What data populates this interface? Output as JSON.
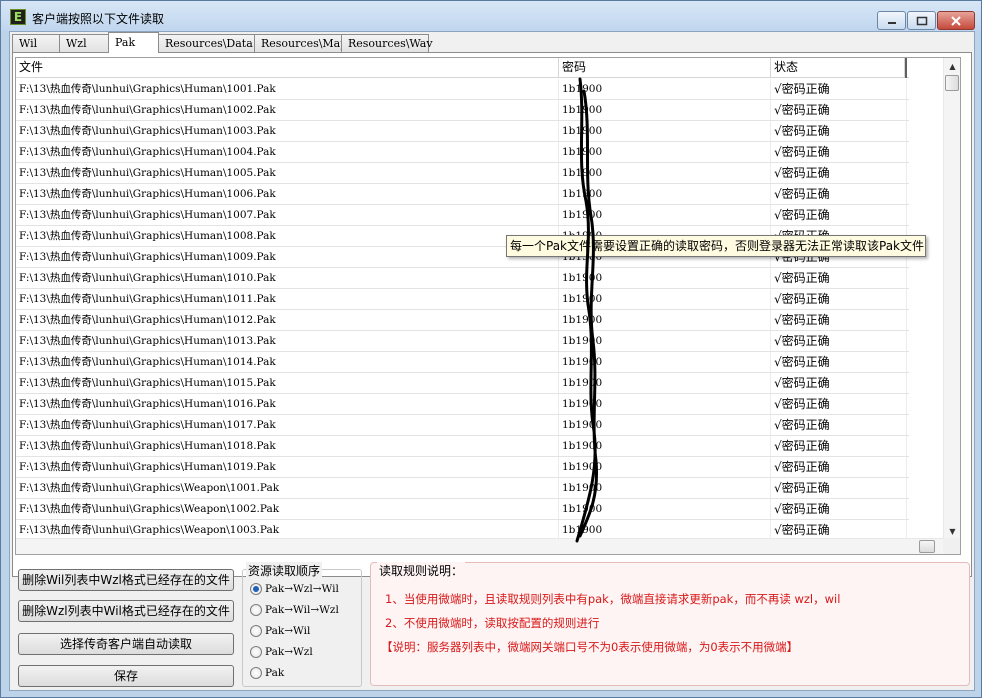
{
  "window": {
    "title": "客户端按照以下文件读取",
    "icon_letter": "E",
    "icons": {
      "minimize": "minimize-icon",
      "maximize": "maximize-icon",
      "close": "close-icon"
    }
  },
  "tabs": [
    {
      "label": "Wil",
      "active": false
    },
    {
      "label": "Wzl",
      "active": false
    },
    {
      "label": "Pak",
      "active": true
    },
    {
      "label": "Resources\\Data",
      "active": false
    },
    {
      "label": "Resources\\Map",
      "active": false
    },
    {
      "label": "Resources\\Wav",
      "active": false
    }
  ],
  "table": {
    "columns": [
      "文件",
      "密码",
      "状态"
    ],
    "rows": [
      {
        "file": "F:\\13\\热血传奇\\lunhui\\Graphics\\Human\\1001.Pak",
        "password": "1b1900",
        "status": "√密码正确"
      },
      {
        "file": "F:\\13\\热血传奇\\lunhui\\Graphics\\Human\\1002.Pak",
        "password": "1b1900",
        "status": "√密码正确"
      },
      {
        "file": "F:\\13\\热血传奇\\lunhui\\Graphics\\Human\\1003.Pak",
        "password": "1b1900",
        "status": "√密码正确"
      },
      {
        "file": "F:\\13\\热血传奇\\lunhui\\Graphics\\Human\\1004.Pak",
        "password": "1b1900",
        "status": "√密码正确"
      },
      {
        "file": "F:\\13\\热血传奇\\lunhui\\Graphics\\Human\\1005.Pak",
        "password": "1b1900",
        "status": "√密码正确"
      },
      {
        "file": "F:\\13\\热血传奇\\lunhui\\Graphics\\Human\\1006.Pak",
        "password": "1b1900",
        "status": "√密码正确"
      },
      {
        "file": "F:\\13\\热血传奇\\lunhui\\Graphics\\Human\\1007.Pak",
        "password": "1b1900",
        "status": "√密码正确"
      },
      {
        "file": "F:\\13\\热血传奇\\lunhui\\Graphics\\Human\\1008.Pak",
        "password": "1b1900",
        "status": "√密码正确"
      },
      {
        "file": "F:\\13\\热血传奇\\lunhui\\Graphics\\Human\\1009.Pak",
        "password": "1b1900",
        "status": "√密码正确"
      },
      {
        "file": "F:\\13\\热血传奇\\lunhui\\Graphics\\Human\\1010.Pak",
        "password": "1b1900",
        "status": "√密码正确"
      },
      {
        "file": "F:\\13\\热血传奇\\lunhui\\Graphics\\Human\\1011.Pak",
        "password": "1b1900",
        "status": "√密码正确"
      },
      {
        "file": "F:\\13\\热血传奇\\lunhui\\Graphics\\Human\\1012.Pak",
        "password": "1b1900",
        "status": "√密码正确"
      },
      {
        "file": "F:\\13\\热血传奇\\lunhui\\Graphics\\Human\\1013.Pak",
        "password": "1b1900",
        "status": "√密码正确"
      },
      {
        "file": "F:\\13\\热血传奇\\lunhui\\Graphics\\Human\\1014.Pak",
        "password": "1b1900",
        "status": "√密码正确"
      },
      {
        "file": "F:\\13\\热血传奇\\lunhui\\Graphics\\Human\\1015.Pak",
        "password": "1b1900",
        "status": "√密码正确"
      },
      {
        "file": "F:\\13\\热血传奇\\lunhui\\Graphics\\Human\\1016.Pak",
        "password": "1b1900",
        "status": "√密码正确"
      },
      {
        "file": "F:\\13\\热血传奇\\lunhui\\Graphics\\Human\\1017.Pak",
        "password": "1b1900",
        "status": "√密码正确"
      },
      {
        "file": "F:\\13\\热血传奇\\lunhui\\Graphics\\Human\\1018.Pak",
        "password": "1b1900",
        "status": "√密码正确"
      },
      {
        "file": "F:\\13\\热血传奇\\lunhui\\Graphics\\Human\\1019.Pak",
        "password": "1b1900",
        "status": "√密码正确"
      },
      {
        "file": "F:\\13\\热血传奇\\lunhui\\Graphics\\Weapon\\1001.Pak",
        "password": "1b1900",
        "status": "√密码正确"
      },
      {
        "file": "F:\\13\\热血传奇\\lunhui\\Graphics\\Weapon\\1002.Pak",
        "password": "1b1900",
        "status": "√密码正确"
      },
      {
        "file": "F:\\13\\热血传奇\\lunhui\\Graphics\\Weapon\\1003.Pak",
        "password": "1b1900",
        "status": "√密码正确"
      }
    ]
  },
  "tooltip": "每一个Pak文件需要设置正确的读取密码，否则登录器无法正常读取该Pak文件",
  "buttons": {
    "delete_wil": "删除Wil列表中Wzl格式已经存在的文件",
    "delete_wzl": "删除Wzl列表中Wil格式已经存在的文件",
    "auto_read": "选择传奇客户端自动读取",
    "save": "保存"
  },
  "order_group": {
    "title": "资源读取顺序",
    "options": [
      "Pak→Wzl→Wil",
      "Pak→Wil→Wzl",
      "Pak→Wil",
      "Pak→Wzl",
      "Pak"
    ],
    "selected_index": 0
  },
  "rules_group": {
    "title": "读取规则说明：",
    "line1": "1、当使用微端时，且读取规则列表中有pak，微端直接请求更新pak，而不再读 wzl，wil",
    "line2": "2、不使用微端时，读取按配置的规则进行",
    "line3": "【说明：服务器列表中，微端网关端口号不为0表示使用微端，为0表示不用微端】"
  },
  "colors": {
    "rule_text": "#d81818",
    "rules_bg": "#fff4f4",
    "tooltip_bg": "#fffbe0"
  }
}
